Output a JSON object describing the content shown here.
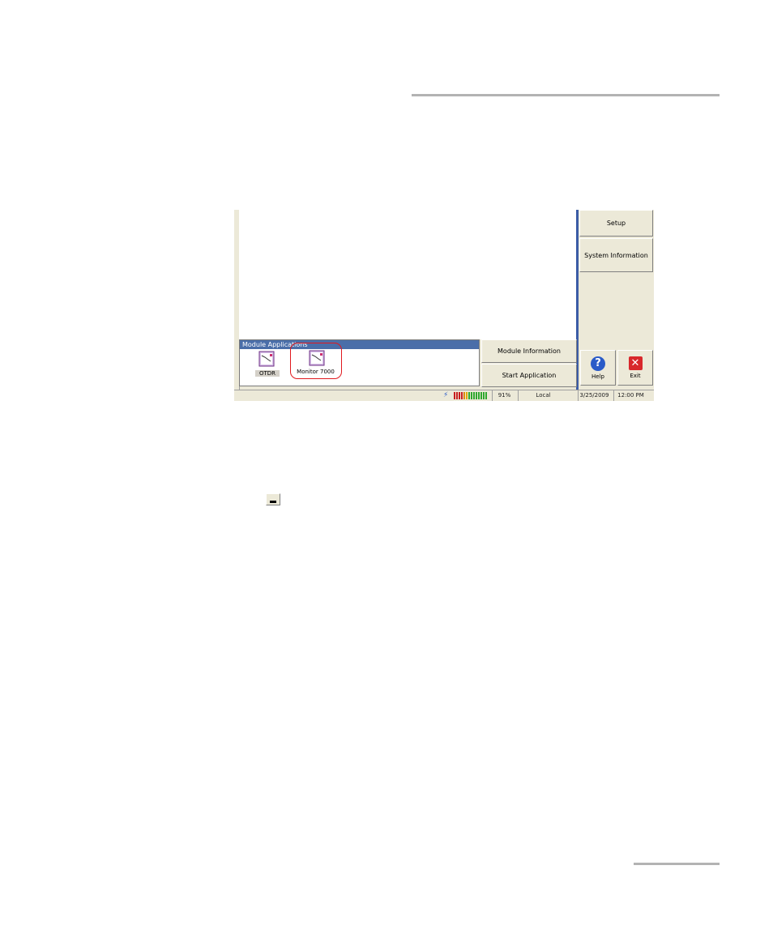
{
  "module_panel": {
    "title": "Module Applications",
    "apps": [
      {
        "label": "OTDR"
      },
      {
        "label": "Monitor 7000"
      }
    ]
  },
  "buttons": {
    "module_information": "Module Information",
    "start_application": "Start Application",
    "setup": "Setup",
    "system_information": "System Information",
    "help": "Help",
    "exit": "Exit"
  },
  "status_bar": {
    "battery": "91%",
    "mode": "Local",
    "date": "3/25/2009",
    "time": "12:00 PM"
  },
  "colors": {
    "title_bar": "#4a6ea9",
    "highlight": "#e0191e",
    "help_icon": "#2a5bc8",
    "exit_icon": "#d8282c"
  }
}
